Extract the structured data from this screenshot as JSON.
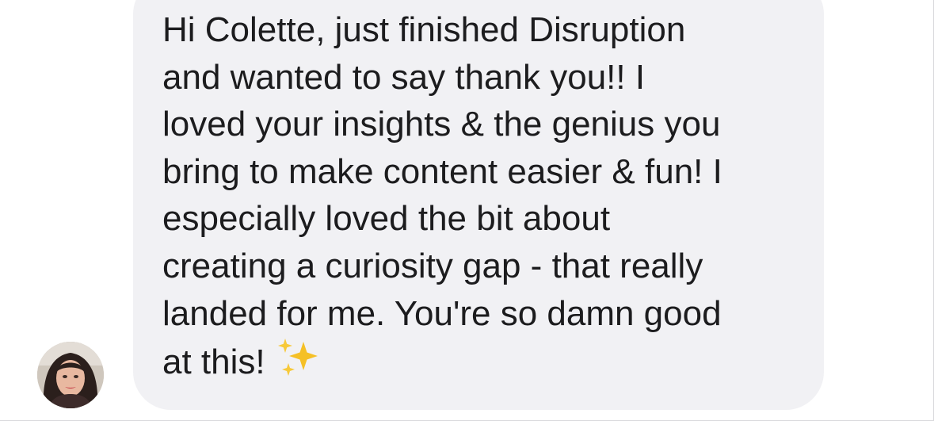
{
  "conversation": {
    "message": {
      "lines": [
        "Hi Colette, just finished Disruption",
        "and wanted to say thank you!! I",
        "loved your insights & the genius you",
        "bring to make content easier & fun! I",
        "especially loved the bit about",
        "creating a curiosity gap - that really",
        "landed for me. You're so damn good",
        "at this!"
      ],
      "emoji": "sparkles-emoji"
    },
    "sender_avatar": "avatar-photo"
  },
  "colors": {
    "bubble_background": "#f1f1f4",
    "text": "#1c1c1e",
    "sparkle": "#f5c026"
  }
}
